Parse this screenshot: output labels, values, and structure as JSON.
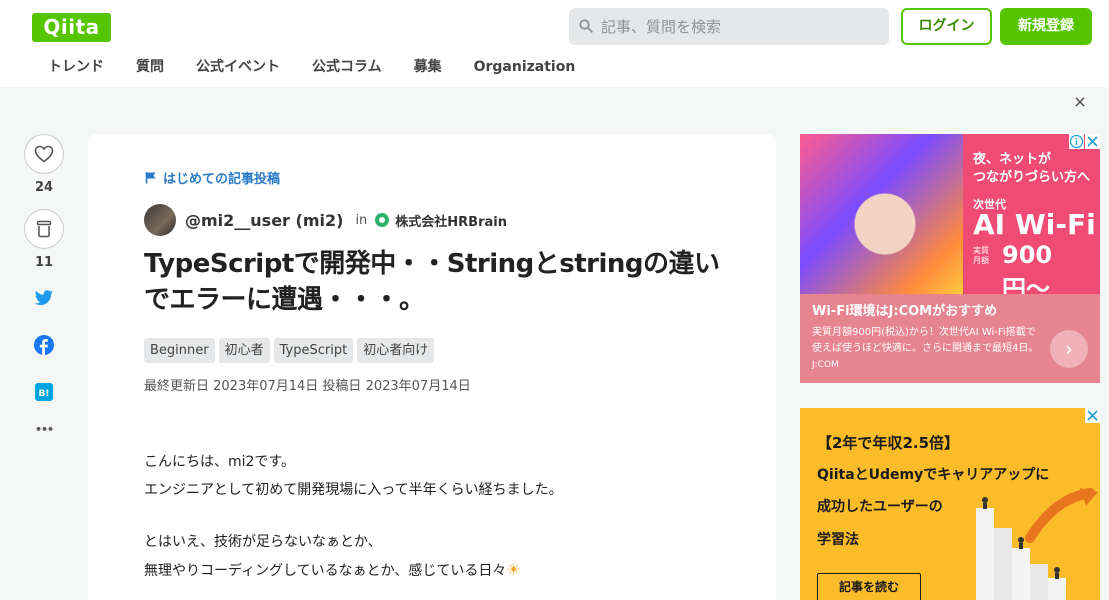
{
  "header": {
    "logo": "Qiita",
    "search_placeholder": "記事、質問を検索",
    "login_label": "ログイン",
    "signup_label": "新規登録",
    "nav": [
      "トレンド",
      "質問",
      "公式イベント",
      "公式コラム",
      "募集",
      "Organization"
    ],
    "close_symbol": "×"
  },
  "actions": {
    "like_count": "24",
    "stock_count": "11",
    "more_symbol": "•••"
  },
  "article": {
    "topic": "はじめての記事投稿",
    "author": "@mi2__user (mi2)",
    "in_word": "in",
    "organization": "株式会社HRBrain",
    "title_line1": "TypeScriptで開発中・・Stringとstringの違い",
    "title_line2": "でエラーに遭遇・・・。",
    "tags": [
      "Beginner",
      "初心者",
      "TypeScript",
      "初心者向け"
    ],
    "dates": "最終更新日 2023年07月14日  投稿日 2023年07月14日",
    "body": [
      "こんにちは、mi2です。",
      "エンジニアとして初めて開発現場に入って半年くらい経ちました。",
      "とはいえ、技術が足らないなぁとか、",
      "無理やりコーディングしているなぁとか、感じている日々"
    ],
    "body_emoji": "☀"
  },
  "ad1": {
    "headline": "夜、ネットが\nつながりづらい方へ",
    "subhead": "次世代",
    "product": "AI Wi-Fi",
    "price_label": "実質\n月額",
    "price": "900円〜",
    "bottom_title": "Wi-Fi環境はJ:COMがおすすめ",
    "bottom_text": "実質月額900円(税込)から！次世代AI Wi-Fi搭載で使えば使うほど快適に。さらに開通まで最短4日。",
    "source": "J:COM",
    "arrow": "›"
  },
  "ad2": {
    "line1": "【2年で年収2.5倍】",
    "line2": "QiitaとUdemyでキャリアアップに",
    "line3": "成功したユーザーの",
    "line4": "学習法",
    "cta": "記事を読む"
  }
}
